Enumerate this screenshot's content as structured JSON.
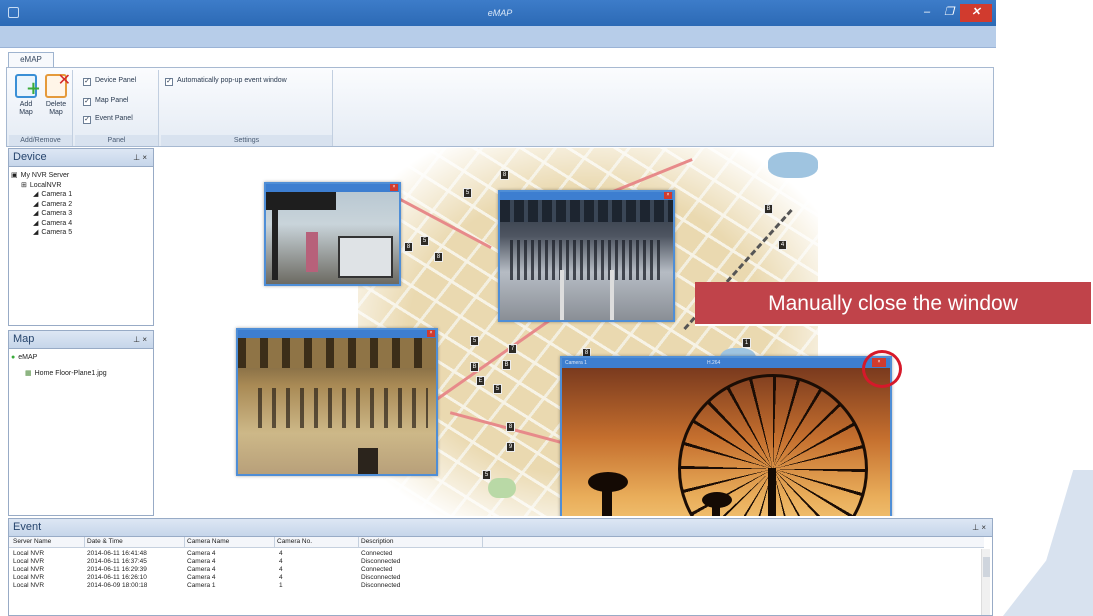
{
  "window": {
    "title": "eMAP",
    "controls": {
      "minimize": "–",
      "maximize": "❐",
      "close": "✕"
    }
  },
  "ribbon": {
    "tab": "eMAP",
    "groups": {
      "add_remove": {
        "label": "Add/Remove",
        "add": "Add Map",
        "delete": "Delete Map"
      },
      "panel": {
        "label": "Panel",
        "options": [
          "Device Panel",
          "Map Panel",
          "Event Panel"
        ]
      },
      "settings": {
        "label": "Settings",
        "option": "Automatically pop-up event window"
      }
    },
    "check_mark": "✓"
  },
  "device_panel": {
    "title": "Device",
    "pin": "⊥ ×",
    "tree": {
      "server": "My NVR Server",
      "nvr": "LocalNVR",
      "cameras": [
        "Camera 1",
        "Camera 2",
        "Camera 3",
        "Camera 4",
        "Camera 5"
      ]
    }
  },
  "map_panel": {
    "title": "Map",
    "pin": "⊥ ×",
    "tree": {
      "root": "eMAP",
      "child": "Home Floor-Plane1.jpg"
    }
  },
  "map_markers": [
    "5",
    "8",
    "B",
    "8",
    "5",
    "8",
    "5",
    "B",
    "E",
    "5",
    "B",
    "7",
    "8",
    "8",
    "9",
    "5",
    "1",
    "2",
    "4"
  ],
  "camera_windows": [
    {
      "title": "",
      "close": "×"
    },
    {
      "title": "",
      "close": "×"
    },
    {
      "title": "",
      "close": "×"
    },
    {
      "title": "Camera 1",
      "subtitle": "H.264",
      "close": "×"
    }
  ],
  "event_panel": {
    "title": "Event",
    "pin": "⊥ ×",
    "columns": [
      "Server Name",
      "Date & Time",
      "Camera Name",
      "Camera No.",
      "Description"
    ],
    "rows": [
      [
        "Local NVR",
        "2014-06-11 16:41:48",
        "Camera 4",
        "4",
        "Connected"
      ],
      [
        "Local NVR",
        "2014-06-11 16:37:45",
        "Camera 4",
        "4",
        "Disconnected"
      ],
      [
        "Local NVR",
        "2014-06-11 16:29:39",
        "Camera 4",
        "4",
        "Connected"
      ],
      [
        "Local NVR",
        "2014-06-11 16:26:10",
        "Camera 4",
        "4",
        "Disconnected"
      ],
      [
        "Local NVR",
        "2014-06-09 18:00:18",
        "Camera 1",
        "1",
        "Disconnected"
      ]
    ]
  },
  "callout": "Manually close the window",
  "colors": {
    "titlebar": "#2c6ab5",
    "callout": "#c0434a",
    "highlight": "#d6192a"
  }
}
